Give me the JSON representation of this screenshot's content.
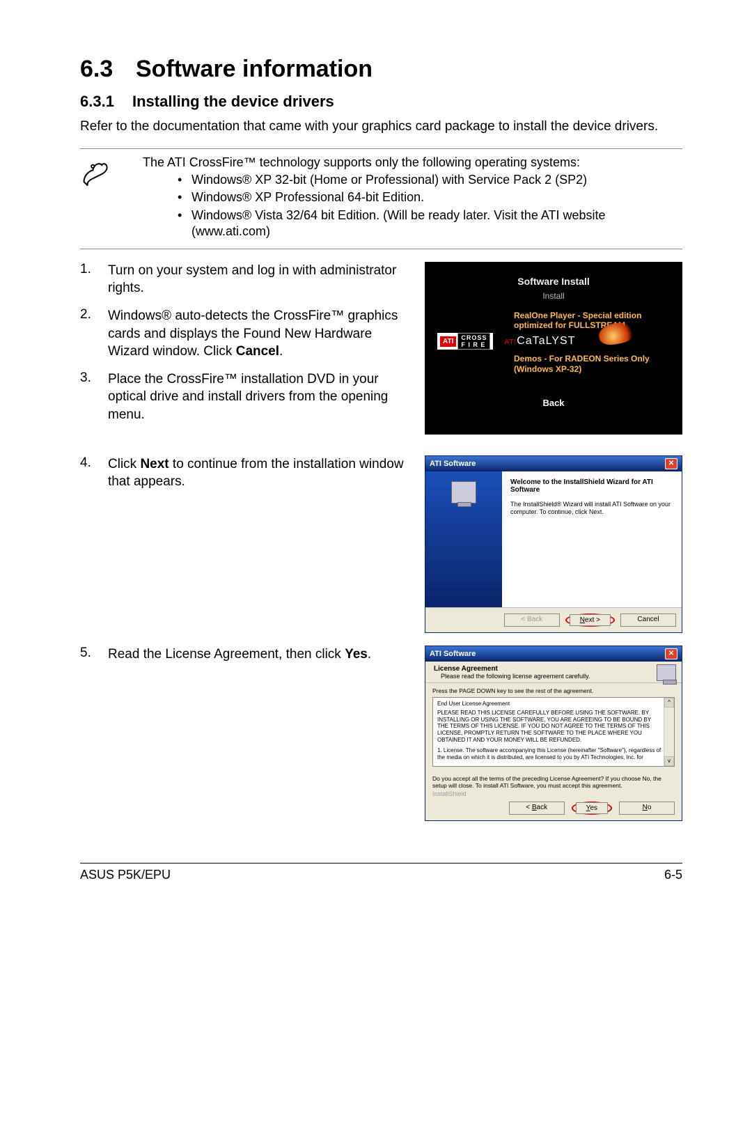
{
  "section": {
    "number": "6.3",
    "title": "Software information"
  },
  "subsection": {
    "number": "6.3.1",
    "title": "Installing the device drivers"
  },
  "intro": "Refer to the documentation that came with your graphics card package to install the device drivers.",
  "note": {
    "lead": "The ATI CrossFire™ technology supports only the following operating systems:",
    "bullets": [
      "Windows® XP 32-bit  (Home or Professional) with Service Pack 2 (SP2)",
      "Windows® XP Professional 64-bit Edition.",
      "Windows® Vista 32/64 bit Edition. (Will be ready later. Visit the ATI website (www.ati.com)"
    ]
  },
  "steps_a": [
    {
      "n": "1.",
      "t": "Turn on your system and log in with administrator rights."
    },
    {
      "n": "2.",
      "t_pre": "Windows® auto-detects the CrossFire™ graphics cards and displays the Found New Hardware Wizard window. Click ",
      "t_bold": "Cancel",
      "t_post": "."
    },
    {
      "n": "3.",
      "t": "Place the CrossFire™ installation DVD in your optical drive and install drivers from the opening menu."
    }
  ],
  "step4": {
    "n": "4.",
    "pre": "Click ",
    "bold": "Next",
    "post": " to continue from the installation window that appears."
  },
  "step5": {
    "n": "5.",
    "pre": "Read the License Agreement, then click ",
    "bold": "Yes",
    "post": "."
  },
  "install_menu": {
    "software_install": "Software Install",
    "install": "Install",
    "realone": "RealOne Player - Special edition optimized for FULLSTREAM",
    "ati": "ATI",
    "crossfire_top": "CROSS",
    "crossfire_bot": "F I R E",
    "catalyst_prefix": "ATI",
    "catalyst": "CaTaLYST",
    "demos": "Demos - For RADEON Series Only (Windows XP-32)",
    "back": "Back"
  },
  "wizard1": {
    "title": "ATI Software",
    "welcome": "Welcome to the InstallShield Wizard for ATI Software",
    "desc": "The InstallShield® Wizard will install ATI Software on your computer.  To continue, click Next.",
    "back": "< Back",
    "next": "Next >",
    "cancel": "Cancel"
  },
  "wizard2": {
    "title": "ATI Software",
    "la_title": "License Agreement",
    "la_sub": "Please read the following license agreement carefully.",
    "press": "Press the PAGE DOWN key to see the rest of the agreement.",
    "eula_title": "End User License Agreement",
    "eula_body1": "PLEASE READ THIS LICENSE CAREFULLY BEFORE USING THE SOFTWARE. BY INSTALLING OR USING THE SOFTWARE, YOU ARE AGREEING TO BE BOUND BY THE TERMS OF THIS LICENSE. IF YOU DO NOT AGREE TO THE TERMS OF THIS LICENSE, PROMPTLY RETURN THE SOFTWARE TO THE PLACE WHERE YOU OBTAINED IT AND YOUR MONEY WILL BE REFUNDED.",
    "eula_body2": "1. License.  The software accompanying this License (hereinafter \"Software\"), regardless of the media on which it is distributed, are licensed to you by ATI Technologies, Inc. for",
    "accept": "Do you accept all the terms of the preceding License Agreement?  If you choose No,  the setup will close.  To install ATI Software, you must accept this agreement.",
    "installshield": "InstallShield",
    "back": "< Back",
    "yes": "Yes",
    "no": "No"
  },
  "footer": {
    "left": "ASUS P5K/EPU",
    "right": "6-5"
  }
}
